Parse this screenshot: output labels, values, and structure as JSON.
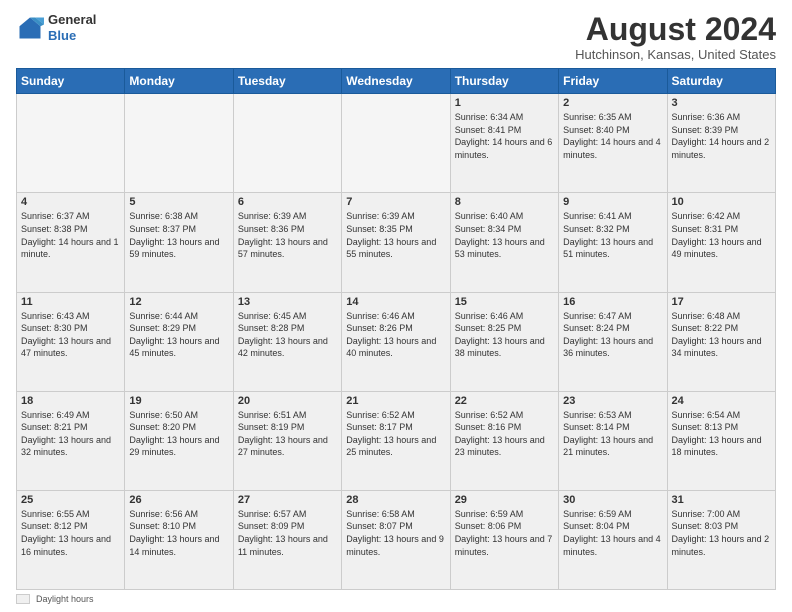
{
  "header": {
    "logo_general": "General",
    "logo_blue": "Blue",
    "month_title": "August 2024",
    "location": "Hutchinson, Kansas, United States"
  },
  "days_of_week": [
    "Sunday",
    "Monday",
    "Tuesday",
    "Wednesday",
    "Thursday",
    "Friday",
    "Saturday"
  ],
  "legend": {
    "box_label": "Daylight hours"
  },
  "weeks": [
    [
      {
        "day": "",
        "empty": true
      },
      {
        "day": "",
        "empty": true
      },
      {
        "day": "",
        "empty": true
      },
      {
        "day": "",
        "empty": true
      },
      {
        "day": "1",
        "sunrise": "6:34 AM",
        "sunset": "8:41 PM",
        "daylight": "14 hours and 6 minutes."
      },
      {
        "day": "2",
        "sunrise": "6:35 AM",
        "sunset": "8:40 PM",
        "daylight": "14 hours and 4 minutes."
      },
      {
        "day": "3",
        "sunrise": "6:36 AM",
        "sunset": "8:39 PM",
        "daylight": "14 hours and 2 minutes."
      }
    ],
    [
      {
        "day": "4",
        "sunrise": "6:37 AM",
        "sunset": "8:38 PM",
        "daylight": "14 hours and 1 minute."
      },
      {
        "day": "5",
        "sunrise": "6:38 AM",
        "sunset": "8:37 PM",
        "daylight": "13 hours and 59 minutes."
      },
      {
        "day": "6",
        "sunrise": "6:39 AM",
        "sunset": "8:36 PM",
        "daylight": "13 hours and 57 minutes."
      },
      {
        "day": "7",
        "sunrise": "6:39 AM",
        "sunset": "8:35 PM",
        "daylight": "13 hours and 55 minutes."
      },
      {
        "day": "8",
        "sunrise": "6:40 AM",
        "sunset": "8:34 PM",
        "daylight": "13 hours and 53 minutes."
      },
      {
        "day": "9",
        "sunrise": "6:41 AM",
        "sunset": "8:32 PM",
        "daylight": "13 hours and 51 minutes."
      },
      {
        "day": "10",
        "sunrise": "6:42 AM",
        "sunset": "8:31 PM",
        "daylight": "13 hours and 49 minutes."
      }
    ],
    [
      {
        "day": "11",
        "sunrise": "6:43 AM",
        "sunset": "8:30 PM",
        "daylight": "13 hours and 47 minutes."
      },
      {
        "day": "12",
        "sunrise": "6:44 AM",
        "sunset": "8:29 PM",
        "daylight": "13 hours and 45 minutes."
      },
      {
        "day": "13",
        "sunrise": "6:45 AM",
        "sunset": "8:28 PM",
        "daylight": "13 hours and 42 minutes."
      },
      {
        "day": "14",
        "sunrise": "6:46 AM",
        "sunset": "8:26 PM",
        "daylight": "13 hours and 40 minutes."
      },
      {
        "day": "15",
        "sunrise": "6:46 AM",
        "sunset": "8:25 PM",
        "daylight": "13 hours and 38 minutes."
      },
      {
        "day": "16",
        "sunrise": "6:47 AM",
        "sunset": "8:24 PM",
        "daylight": "13 hours and 36 minutes."
      },
      {
        "day": "17",
        "sunrise": "6:48 AM",
        "sunset": "8:22 PM",
        "daylight": "13 hours and 34 minutes."
      }
    ],
    [
      {
        "day": "18",
        "sunrise": "6:49 AM",
        "sunset": "8:21 PM",
        "daylight": "13 hours and 32 minutes."
      },
      {
        "day": "19",
        "sunrise": "6:50 AM",
        "sunset": "8:20 PM",
        "daylight": "13 hours and 29 minutes."
      },
      {
        "day": "20",
        "sunrise": "6:51 AM",
        "sunset": "8:19 PM",
        "daylight": "13 hours and 27 minutes."
      },
      {
        "day": "21",
        "sunrise": "6:52 AM",
        "sunset": "8:17 PM",
        "daylight": "13 hours and 25 minutes."
      },
      {
        "day": "22",
        "sunrise": "6:52 AM",
        "sunset": "8:16 PM",
        "daylight": "13 hours and 23 minutes."
      },
      {
        "day": "23",
        "sunrise": "6:53 AM",
        "sunset": "8:14 PM",
        "daylight": "13 hours and 21 minutes."
      },
      {
        "day": "24",
        "sunrise": "6:54 AM",
        "sunset": "8:13 PM",
        "daylight": "13 hours and 18 minutes."
      }
    ],
    [
      {
        "day": "25",
        "sunrise": "6:55 AM",
        "sunset": "8:12 PM",
        "daylight": "13 hours and 16 minutes."
      },
      {
        "day": "26",
        "sunrise": "6:56 AM",
        "sunset": "8:10 PM",
        "daylight": "13 hours and 14 minutes."
      },
      {
        "day": "27",
        "sunrise": "6:57 AM",
        "sunset": "8:09 PM",
        "daylight": "13 hours and 11 minutes."
      },
      {
        "day": "28",
        "sunrise": "6:58 AM",
        "sunset": "8:07 PM",
        "daylight": "13 hours and 9 minutes."
      },
      {
        "day": "29",
        "sunrise": "6:59 AM",
        "sunset": "8:06 PM",
        "daylight": "13 hours and 7 minutes."
      },
      {
        "day": "30",
        "sunrise": "6:59 AM",
        "sunset": "8:04 PM",
        "daylight": "13 hours and 4 minutes."
      },
      {
        "day": "31",
        "sunrise": "7:00 AM",
        "sunset": "8:03 PM",
        "daylight": "13 hours and 2 minutes."
      }
    ]
  ]
}
